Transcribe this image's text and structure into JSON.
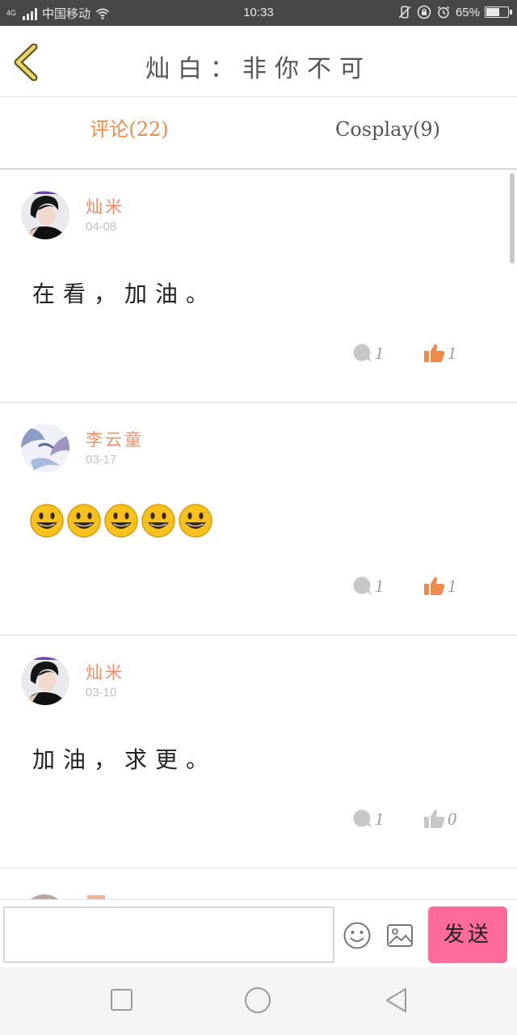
{
  "status_bar": {
    "network_type": "4G",
    "carrier": "中国移动",
    "time": "10:33",
    "battery": "65%",
    "battery_level": 0.65,
    "icons": [
      "signal-icon",
      "wifi-icon",
      "mute-icon",
      "screen-lock-icon",
      "alarm-icon",
      "battery-icon"
    ]
  },
  "header": {
    "title": "灿白：非你不可",
    "back_icon": "back-chevron-icon"
  },
  "tabs": [
    {
      "label": "评论(22)",
      "active": true
    },
    {
      "label": "Cosplay(9)",
      "active": false
    }
  ],
  "comments": [
    {
      "username": "灿米",
      "date": "04-08",
      "text": "在看，加油。",
      "emoji_count": 0,
      "reply_count": "1",
      "like_count": "1",
      "liked": true
    },
    {
      "username": "李云童",
      "date": "03-17",
      "text": "",
      "emoji_count": 5,
      "reply_count": "1",
      "like_count": "1",
      "liked": true
    },
    {
      "username": "灿米",
      "date": "03-10",
      "text": "加油，求更。",
      "emoji_count": 0,
      "reply_count": "1",
      "like_count": "0",
      "liked": false
    }
  ],
  "composer": {
    "input_value": "",
    "input_placeholder": "",
    "send_label": "发送"
  },
  "colors": {
    "accent": "#f08a4a",
    "username": "#f0906a",
    "send_button": "#ff6b9a",
    "status_bar": "#474747"
  }
}
